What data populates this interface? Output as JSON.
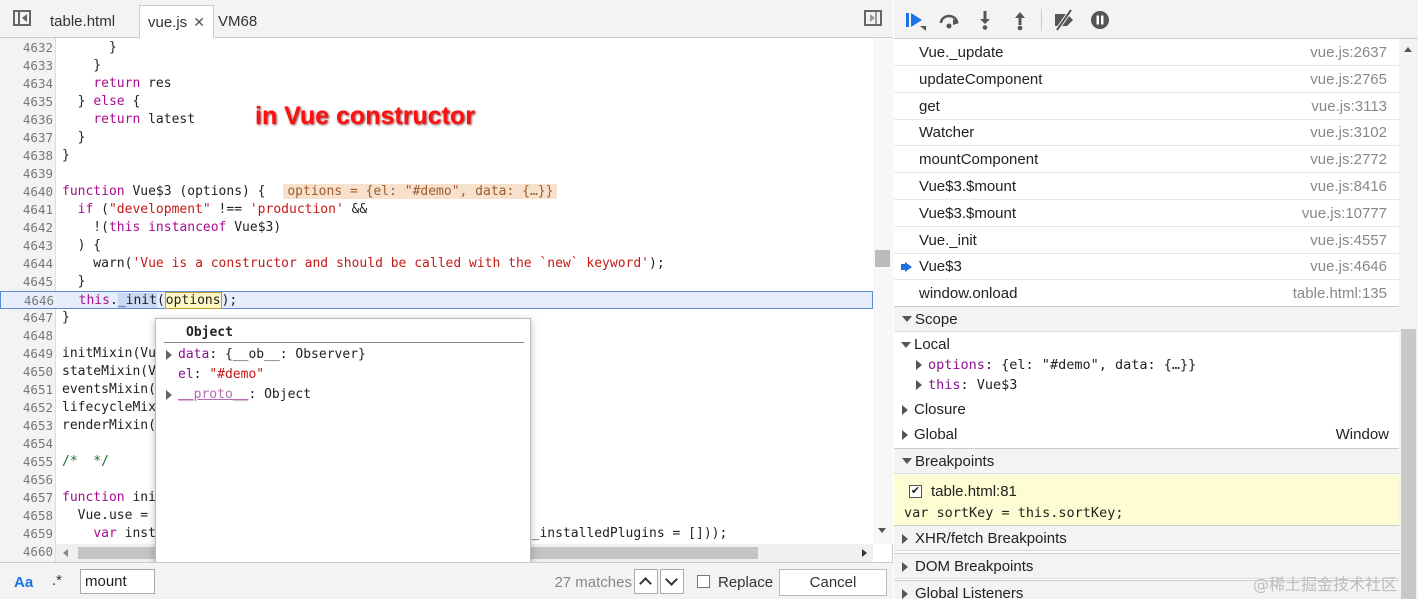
{
  "tabs": [
    {
      "label": "table.html"
    },
    {
      "label": "vue.js",
      "close": "✕"
    },
    {
      "label": "VM68"
    }
  ],
  "annotation": "in Vue constructor",
  "code": {
    "lines": [
      {
        "n": "4632",
        "html": "      }"
      },
      {
        "n": "4633",
        "html": "    }"
      },
      {
        "n": "4634",
        "html": "    <span class=\"kw\">return</span> res"
      },
      {
        "n": "4635",
        "html": "  } <span class=\"kw\">else</span> {"
      },
      {
        "n": "4636",
        "html": "    <span class=\"kw\">return</span> latest"
      },
      {
        "n": "4637",
        "html": "  }"
      },
      {
        "n": "4638",
        "html": "}"
      },
      {
        "n": "4639",
        "html": ""
      },
      {
        "n": "4640",
        "html": "<span class=\"kw\">function</span> Vue$3 (options) { <span class=\"inline-val\">options = {el: \"#demo\", data: {…}}</span>"
      },
      {
        "n": "4641",
        "html": "  <span class=\"kw\">if</span> (<span class=\"str\">\"development\"</span> !== <span class=\"str\">'production'</span> &amp;&amp;"
      },
      {
        "n": "4642",
        "html": "    !(<span class=\"kw\">this</span> <span class=\"kw\">instanceof</span> Vue$3)"
      },
      {
        "n": "4643",
        "html": "  ) {"
      },
      {
        "n": "4644",
        "html": "    warn(<span class=\"str\">'Vue is a constructor and should be called with the `new` keyword'</span>);"
      },
      {
        "n": "4645",
        "html": "  }"
      },
      {
        "n": "4646",
        "html": "  <span class=\"kw\">this</span>.<span class=\"sel\">_init</span>(<span class=\"sel-box\">options</span>);",
        "highlight": true
      },
      {
        "n": "4647",
        "html": "}"
      },
      {
        "n": "4648",
        "html": ""
      },
      {
        "n": "4649",
        "html": "initMixin(Vue$3);"
      },
      {
        "n": "4650",
        "html": "stateMixin(Vue$3);"
      },
      {
        "n": "4651",
        "html": "eventsMixin(Vue$3);"
      },
      {
        "n": "4652",
        "html": "lifecycleMixin(Vue$3);"
      },
      {
        "n": "4653",
        "html": "renderMixin(Vue$3);"
      },
      {
        "n": "4654",
        "html": ""
      },
      {
        "n": "4655",
        "html": "<span class=\"cm\">/*  */</span>"
      },
      {
        "n": "4656",
        "html": ""
      },
      {
        "n": "4657",
        "html": "<span class=\"kw\">function</span> initUse (Vue) {"
      },
      {
        "n": "4658",
        "html": "  Vue.use = <span class=\"kw\">function</span> (plugin) {"
      },
      {
        "n": "4659",
        "html": "    <span class=\"kw\">var</span> installedPlugins = (<span class=\"kw\">this</span>._installedPlugins || (<span class=\"kw\">this</span>._installedPlugins = []));"
      },
      {
        "n": "4660",
        "html": ""
      }
    ]
  },
  "popover": {
    "title": "Object",
    "props": [
      {
        "expandable": true,
        "name": "data",
        "sep": ": ",
        "value": "{__ob__: Observer}"
      },
      {
        "expandable": false,
        "name": "el",
        "sep": ": ",
        "value": "\"#demo\""
      },
      {
        "expandable": true,
        "name": "__proto__",
        "sep": ": ",
        "value": "Object"
      }
    ]
  },
  "search": {
    "case_label": "Aa",
    "regex_label": ".*",
    "value": "mount",
    "matches": "27 matches",
    "replace_label": "Replace",
    "cancel_label": "Cancel"
  },
  "callstack": [
    {
      "name": "Vue._update",
      "loc": "vue.js:2637"
    },
    {
      "name": "updateComponent",
      "loc": "vue.js:2765"
    },
    {
      "name": "get",
      "loc": "vue.js:3113"
    },
    {
      "name": "Watcher",
      "loc": "vue.js:3102"
    },
    {
      "name": "mountComponent",
      "loc": "vue.js:2772"
    },
    {
      "name": "Vue$3.$mount",
      "loc": "vue.js:8416"
    },
    {
      "name": "Vue$3.$mount",
      "loc": "vue.js:10777"
    },
    {
      "name": "Vue._init",
      "loc": "vue.js:4557"
    },
    {
      "name": "Vue$3",
      "loc": "vue.js:4646",
      "current": true
    },
    {
      "name": "window.onload",
      "loc": "table.html:135"
    }
  ],
  "scope": {
    "header": "Scope",
    "local_label": "Local",
    "local_items": [
      {
        "name": "options",
        "value": "{el: \"#demo\", data: {…}}"
      },
      {
        "name": "this",
        "value": "Vue$3"
      }
    ],
    "closure_label": "Closure",
    "global_label": "Global",
    "global_value": "Window"
  },
  "breakpoints": {
    "header": "Breakpoints",
    "file": "table.html:81",
    "code": "var sortKey = this.sortKey;",
    "checkmark": "✔"
  },
  "sections": {
    "xhr": "XHR/fetch Breakpoints",
    "dom": "DOM Breakpoints",
    "listeners": "Global Listeners"
  },
  "watermark": "@稀土掘金技术社区",
  "colors": {
    "accent": "#1a73e8",
    "annotation": "#ff1010",
    "highlight_line": "#e6eefb",
    "breakpoint_bg": "#fefcd2"
  }
}
